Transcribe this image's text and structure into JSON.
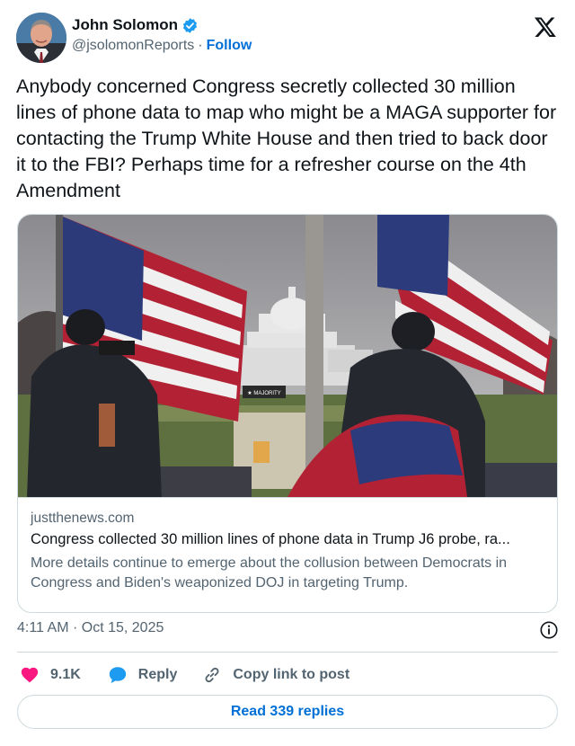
{
  "author": {
    "name": "John Solomon",
    "handle": "@jsolomonReports",
    "separator": "·",
    "follow_label": "Follow"
  },
  "icons": {
    "verified": "verified-badge-icon",
    "brand": "x-logo-icon",
    "info": "info-icon",
    "like": "heart-icon",
    "reply": "speech-bubble-icon",
    "copy": "link-icon"
  },
  "tweet": {
    "text": "Anybody concerned Congress secretly collected 30 million lines of phone data to map who might be a MAGA supporter for contacting the Trump White House and then tried to back door it to the FBI? Perhaps time for a refresher course on the 4th Amendment"
  },
  "card": {
    "image_sign_text": "★ MAJORITY",
    "domain": "justthenews.com",
    "title": "Congress collected 30 million lines of phone data in Trump J6 probe, ra...",
    "description": "More details continue to emerge about the collusion between Democrats in Congress and Biden's weaponized DOJ in targeting Trump."
  },
  "meta": {
    "time": "4:11 AM",
    "separator": "·",
    "date": "Oct 15, 2025"
  },
  "actions": {
    "like_count": "9.1K",
    "reply_label": "Reply",
    "copy_label": "Copy link to post"
  },
  "replies": {
    "label": "Read 339 replies"
  },
  "colors": {
    "link_blue": "#006fd6",
    "verified_blue": "#1d9bf0",
    "like_red": "#f91880",
    "text_primary": "#0f1419",
    "text_secondary": "#536471",
    "border": "#cfd9de"
  }
}
